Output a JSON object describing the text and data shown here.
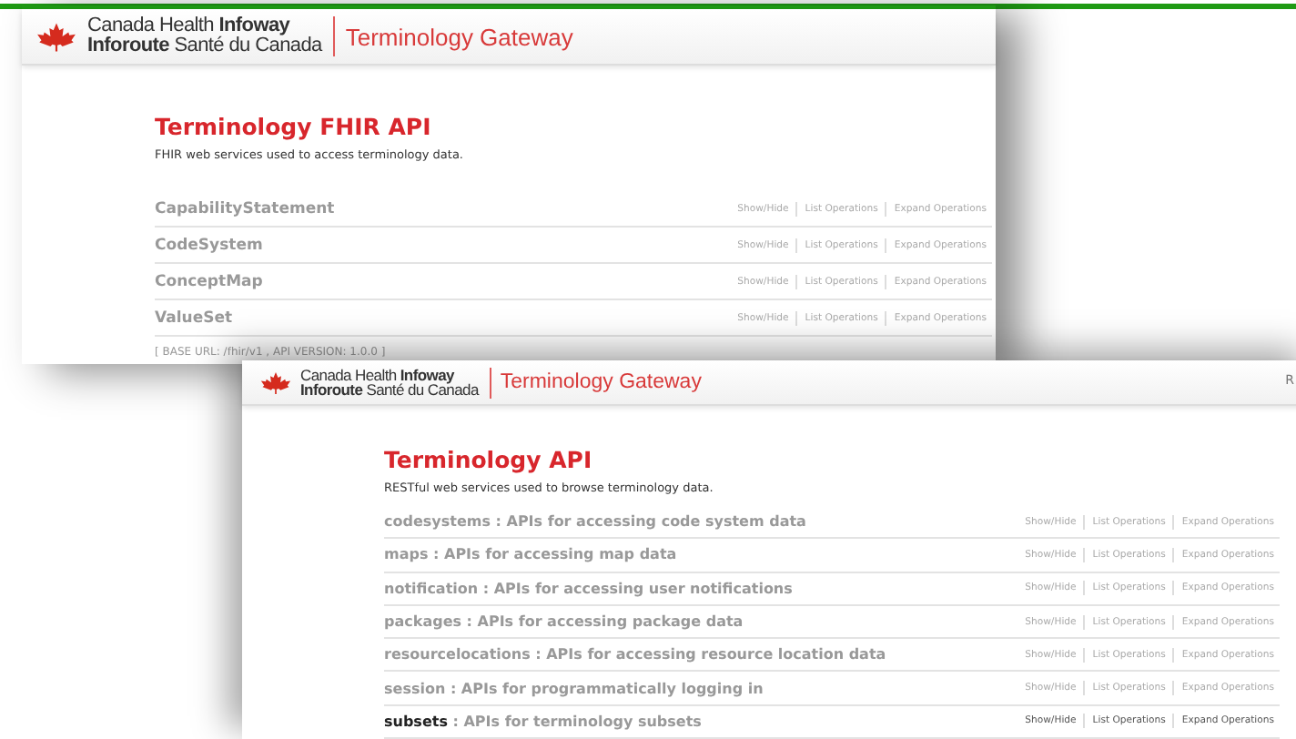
{
  "windows": [
    {
      "header": {
        "logo_line1": "Canada Health **Infoway**",
        "logo_line2": "**Inforoute** Santé du Canada",
        "product": "Terminology Gateway"
      },
      "title": "Terminology FHIR API",
      "description": "FHIR web services used to access terminology data.",
      "rows": [
        {
          "name": "CapabilityStatement",
          "summary": "",
          "highlighted": false,
          "actions": [
            "Show/Hide",
            "List Operations",
            "Expand Operations"
          ]
        },
        {
          "name": "CodeSystem",
          "summary": "",
          "highlighted": false,
          "actions": [
            "Show/Hide",
            "List Operations",
            "Expand Operations"
          ]
        },
        {
          "name": "ConceptMap",
          "summary": "",
          "highlighted": false,
          "actions": [
            "Show/Hide",
            "List Operations",
            "Expand Operations"
          ]
        },
        {
          "name": "ValueSet",
          "summary": "",
          "highlighted": false,
          "actions": [
            "Show/Hide",
            "List Operations",
            "Expand Operations"
          ]
        }
      ],
      "footer": "[ BASE URL: /fhir/v1 , API VERSION: 1.0.0 ]"
    },
    {
      "header": {
        "logo_line1": "Canada Health **Infoway**",
        "logo_line2": "**Inforoute** Santé du Canada",
        "product": "Terminology Gateway",
        "edge_text": "R"
      },
      "title": "Terminology API",
      "description": "RESTful web services used to browse terminology data.",
      "rows": [
        {
          "name": "codesystems",
          "summary": " : APIs for accessing code system data",
          "highlighted": false,
          "actions": [
            "Show/Hide",
            "List Operations",
            "Expand Operations"
          ]
        },
        {
          "name": "maps",
          "summary": " : APIs for accessing map data",
          "highlighted": false,
          "actions": [
            "Show/Hide",
            "List Operations",
            "Expand Operations"
          ]
        },
        {
          "name": "notification",
          "summary": " : APIs for accessing user notifications",
          "highlighted": false,
          "actions": [
            "Show/Hide",
            "List Operations",
            "Expand Operations"
          ]
        },
        {
          "name": "packages",
          "summary": " : APIs for accessing package data",
          "highlighted": false,
          "actions": [
            "Show/Hide",
            "List Operations",
            "Expand Operations"
          ]
        },
        {
          "name": "resourcelocations",
          "summary": " : APIs for accessing resource location data",
          "highlighted": false,
          "actions": [
            "Show/Hide",
            "List Operations",
            "Expand Operations"
          ]
        },
        {
          "name": "session",
          "summary": " : APIs for programmatically logging in",
          "highlighted": false,
          "actions": [
            "Show/Hide",
            "List Operations",
            "Expand Operations"
          ]
        },
        {
          "name": "subsets",
          "summary": " : APIs for terminology subsets",
          "highlighted": true,
          "actions": [
            "Show/Hide",
            "List Operations",
            "Expand Operations"
          ]
        }
      ]
    }
  ]
}
